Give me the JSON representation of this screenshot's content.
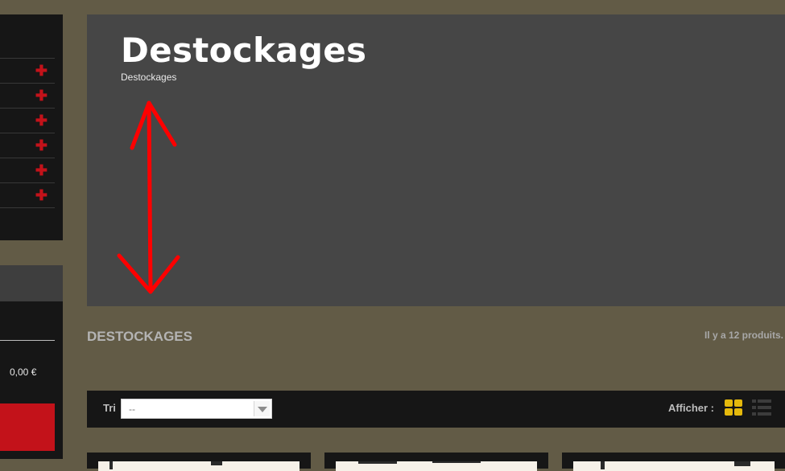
{
  "sidebar": {
    "menu_rows": 7,
    "plus_symbol": "✚"
  },
  "cart": {
    "total": "0,00 €"
  },
  "banner": {
    "title": "Destockages",
    "subtitle": "Destockages",
    "annotation": "double-headed-arrow",
    "annotation_color": "#ff0000"
  },
  "category": {
    "title": "DESTOCKAGES",
    "count_text": "Il y a 12 produits."
  },
  "toolbar": {
    "sort_label": "Tri",
    "sort_value": "--",
    "view_label": "Afficher :",
    "active_view_color": "#e5b90c"
  },
  "products": [
    {
      "name": "product-card-1"
    },
    {
      "name": "product-card-2"
    },
    {
      "name": "product-card-3"
    }
  ]
}
